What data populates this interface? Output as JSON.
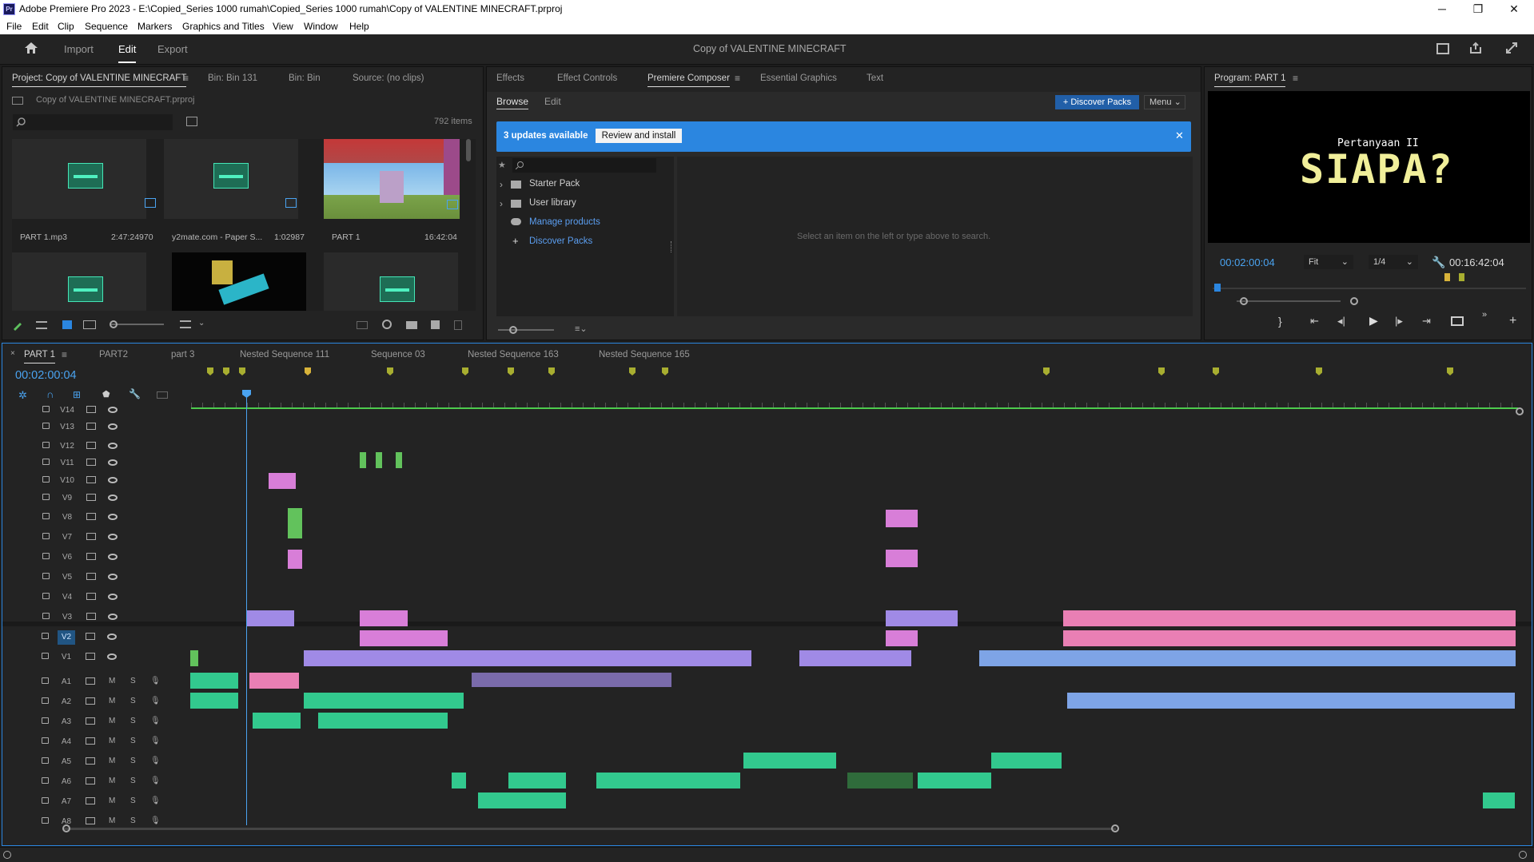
{
  "titlebar": {
    "app_logo": "Pr",
    "title": "Adobe Premiere Pro 2023 - E:\\Copied_Series 1000 rumah\\Copied_Series 1000 rumah\\Copy of VALENTINE MINECRAFT.prproj",
    "minimize": "─",
    "maximize": "❐",
    "close": "✕"
  },
  "menu": [
    "File",
    "Edit",
    "Clip",
    "Sequence",
    "Markers",
    "Graphics and Titles",
    "View",
    "Window",
    "Help"
  ],
  "header": {
    "tabs": [
      "Import",
      "Edit",
      "Export"
    ],
    "active": "Edit",
    "project_name": "Copy of VALENTINE MINECRAFT"
  },
  "project_panel": {
    "tabs": [
      "Project: Copy of VALENTINE MINECRAFT",
      "Bin: Bin 131",
      "Bin: Bin",
      "Source: (no clips)"
    ],
    "file": "Copy of VALENTINE MINECRAFT.prproj",
    "item_count": "792 items",
    "items": [
      {
        "name": "PART 1.mp3",
        "duration": "2:47:24970"
      },
      {
        "name": "y2mate.com - Paper S...",
        "duration": "1:02987"
      },
      {
        "name": "PART 1",
        "duration": "16:42:04"
      }
    ]
  },
  "composer_panel": {
    "tabs": [
      "Effects",
      "Effect Controls",
      "Premiere Composer",
      "Essential Graphics",
      "Text"
    ],
    "active": "Premiere Composer",
    "subtabs": [
      "Browse",
      "Edit"
    ],
    "discover_button": "+ Discover Packs",
    "menu_button": "Menu",
    "banner": {
      "text": "3 updates available",
      "button": "Review and install"
    },
    "tree": [
      "Starter Pack",
      "User library",
      "Manage products",
      "Discover Packs"
    ],
    "empty_hint": "Select an item on the left or type above to search."
  },
  "program_monitor": {
    "title": "Program: PART 1",
    "overlay_line1": "Pertanyaan II",
    "overlay_line2": "SIAPA?",
    "timecode": "00:02:00:04",
    "fit": "Fit",
    "resolution": "1/4",
    "duration": "00:16:42:04",
    "playhead_fraction": 0.0
  },
  "timeline": {
    "tabs": [
      "PART 1",
      "PART2",
      "part 3",
      "Nested Sequence 111",
      "Sequence 03",
      "Nested Sequence 163",
      "Nested Sequence 165"
    ],
    "active": "PART 1",
    "timecode": "00:02:00:04",
    "video_tracks": [
      "V14",
      "V13",
      "V12",
      "V11",
      "V10",
      "V9",
      "V8",
      "V7",
      "V6",
      "V5",
      "V4",
      "V3",
      "V2",
      "V1"
    ],
    "audio_tracks": [
      "A1",
      "A2",
      "A3",
      "A4",
      "A5",
      "A6",
      "A7",
      "A8"
    ],
    "mute_label": "M",
    "solo_label": "S",
    "active_track": "V2"
  },
  "colors": {
    "accent": "#2b86e0",
    "audio_clip": "#32c98e",
    "video_clip": "#d87ed8",
    "nested_clip": "#a08ae6"
  }
}
